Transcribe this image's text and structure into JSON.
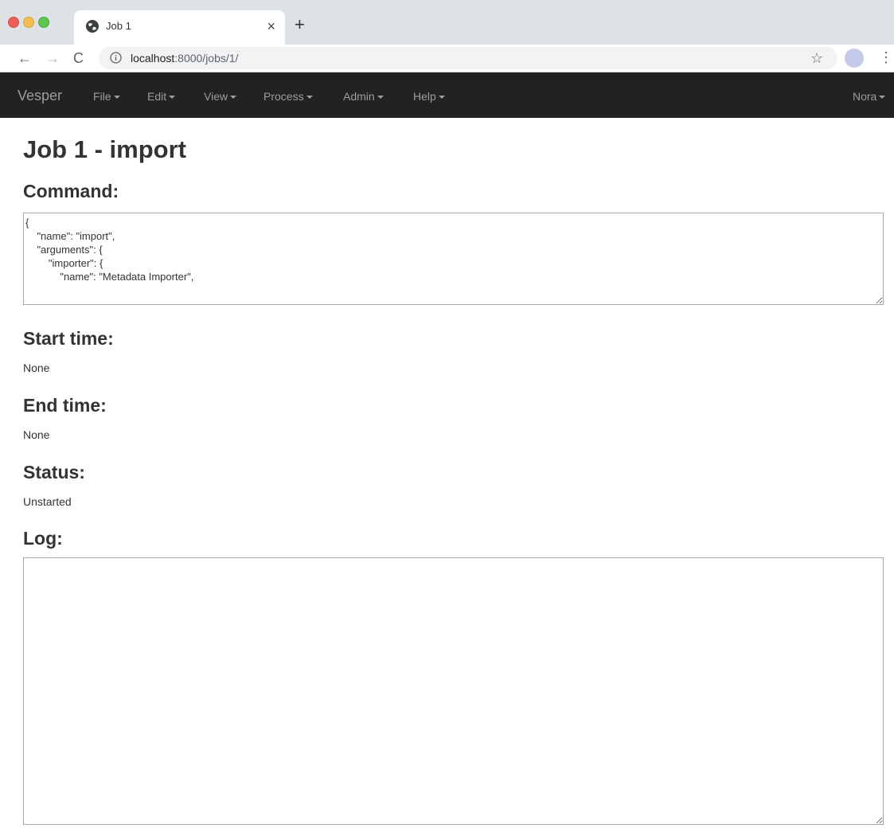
{
  "browser": {
    "tab_title": "Job 1",
    "new_tab_label": "+",
    "close_label": "×",
    "url_host": "localhost",
    "url_path": ":8000/jobs/1/"
  },
  "navbar": {
    "brand": "Vesper",
    "menus": [
      "File",
      "Edit",
      "View",
      "Process",
      "Admin",
      "Help"
    ],
    "user": "Nora"
  },
  "page": {
    "title": "Job 1 - import",
    "command_heading": "Command:",
    "command_value": "{\n    \"name\": \"import\",\n    \"arguments\": {\n        \"importer\": {\n            \"name\": \"Metadata Importer\",",
    "start_heading": "Start time:",
    "start_value": "None",
    "end_heading": "End time:",
    "end_value": "None",
    "status_heading": "Status:",
    "status_value": "Unstarted",
    "log_heading": "Log:",
    "log_value": ""
  }
}
